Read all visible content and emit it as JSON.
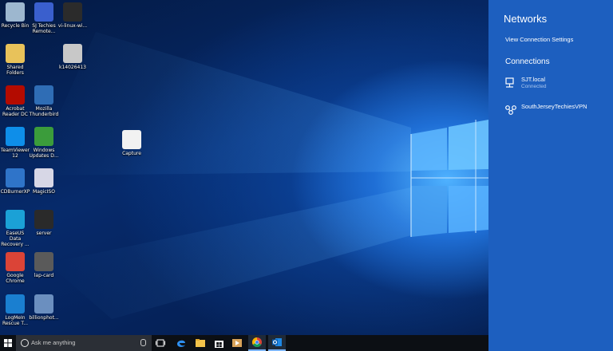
{
  "desktop": {
    "icons": [
      {
        "id": "recycle-bin",
        "label": "Recycle Bin",
        "icon": "recycle-bin-icon",
        "color": "#9db7cf"
      },
      {
        "id": "sj-techies-remote",
        "label": "SJ Techies\nRemote...",
        "icon": "remote-shortcut-icon",
        "color": "#3a5fcd"
      },
      {
        "id": "vi-linux",
        "label": "vi-linux-wi...",
        "icon": "linux-penguin-icon",
        "color": "#2b2b2b"
      },
      {
        "id": "shared-folders",
        "label": "Shared\nFolders",
        "icon": "folder-icon",
        "color": "#e8c25a"
      },
      {
        "id": "k14026413",
        "label": "k14026413",
        "icon": "image-file-icon",
        "color": "#c8c8c8"
      },
      {
        "id": "acrobat",
        "label": "Acrobat\nReader DC",
        "icon": "acrobat-icon",
        "color": "#b30b00"
      },
      {
        "id": "thunderbird",
        "label": "Mozilla\nThunderbird",
        "icon": "thunderbird-icon",
        "color": "#2f6db5"
      },
      {
        "id": "teamviewer",
        "label": "TeamViewer\n12",
        "icon": "teamviewer-icon",
        "color": "#0e8ee9"
      },
      {
        "id": "windows-updates",
        "label": "Windows\nUpdates D...",
        "icon": "windows-update-icon",
        "color": "#3b9c3b"
      },
      {
        "id": "capture",
        "label": "Capture",
        "icon": "capture-image-icon",
        "color": "#f2f2f2"
      },
      {
        "id": "cdburnerxp",
        "label": "CDBurnerXP",
        "icon": "cdburnerxp-icon",
        "color": "#2f74c9"
      },
      {
        "id": "magiciso",
        "label": "MagicISO",
        "icon": "disc-icon",
        "color": "#d7d7e6"
      },
      {
        "id": "easeus",
        "label": "EaseUS Data\nRecovery ...",
        "icon": "easeus-icon",
        "color": "#1ba1d6"
      },
      {
        "id": "server",
        "label": "server",
        "icon": "server-tower-icon",
        "color": "#2a2a2a"
      },
      {
        "id": "chrome",
        "label": "Google\nChrome",
        "icon": "chrome-icon",
        "color": "#db4437"
      },
      {
        "id": "lap-card",
        "label": "lap-card",
        "icon": "network-card-icon",
        "color": "#5a5a5a"
      },
      {
        "id": "logmein",
        "label": "LogMeIn\nRescue T...",
        "icon": "logmein-icon",
        "color": "#1a7fd0"
      },
      {
        "id": "billionphot",
        "label": "billionphot...",
        "icon": "network-device-icon",
        "color": "#6b8fbf"
      }
    ]
  },
  "panel": {
    "title": "Networks",
    "settings_link": "View Connection Settings",
    "section": "Connections",
    "connections": [
      {
        "name": "SJT.local",
        "status": "Connected",
        "icon": "ethernet-icon"
      },
      {
        "name": "SouthJerseyTechiesVPN",
        "status": "",
        "icon": "vpn-icon"
      }
    ]
  },
  "taskbar": {
    "search_placeholder": "Ask me anything",
    "apps": [
      {
        "name": "task-view-icon"
      },
      {
        "name": "edge-icon"
      },
      {
        "name": "file-explorer-icon"
      },
      {
        "name": "store-icon"
      },
      {
        "name": "media-player-icon"
      },
      {
        "name": "chrome-icon"
      },
      {
        "name": "outlook-icon"
      }
    ]
  },
  "colors": {
    "panel": "#1d5fbf",
    "taskbar": "#0c0f14",
    "search_box": "#2b2f36"
  }
}
